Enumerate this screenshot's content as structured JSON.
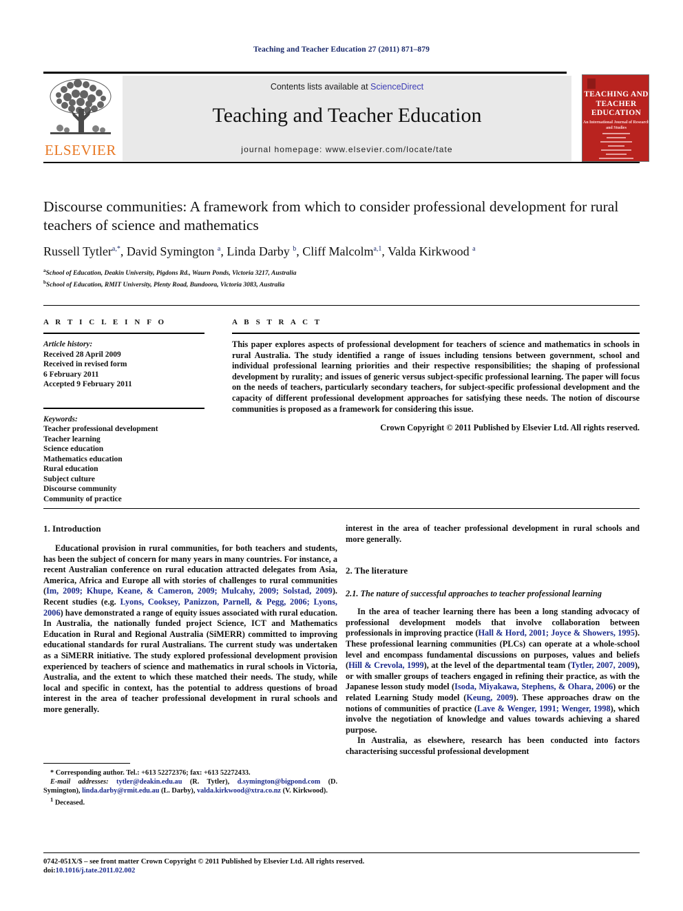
{
  "running_head": "Teaching and Teacher Education 27 (2011) 871–879",
  "masthead": {
    "contents_prefix": "Contents lists available at ",
    "sciencedirect": "ScienceDirect",
    "journal_title": "Teaching and Teacher Education",
    "homepage": "journal homepage: www.elsevier.com/locate/tate",
    "publisher_wordmark": "ELSEVIER",
    "publisher_color": "#e87722",
    "sciencedirect_color": "#3b3bb5",
    "bar_background": "#e9e9e9",
    "cover": {
      "title": "TEACHING AND TEACHER EDUCATION",
      "subtitle": "An International Journal of Research and Studies",
      "background": "#b9231f"
    }
  },
  "article": {
    "title": "Discourse communities: A framework from which to consider professional development for rural teachers of science and mathematics",
    "authors_html": "Russell Tytler<sup>a,*</sup>, David Symington <sup>a</sup>, Linda Darby <sup>b</sup>, Cliff Malcolm<sup>a,1</sup>, Valda Kirkwood <sup>a</sup>",
    "affiliations": [
      "School of Education, Deakin University, Pigdons Rd., Waurn Ponds, Victoria 3217, Australia",
      "School of Education, RMIT University, Plenty Road, Bundoora, Victoria 3083, Australia"
    ],
    "affiliation_markers": [
      "a",
      "b"
    ]
  },
  "article_info": {
    "heading": "A R T I C L E   I N F O",
    "history_label": "Article history:",
    "history": [
      "Received 28 April 2009",
      "Received in revised form",
      "6 February 2011",
      "Accepted 9 February 2011"
    ],
    "keywords_label": "Keywords:",
    "keywords": [
      "Teacher professional development",
      "Teacher learning",
      "Science education",
      "Mathematics education",
      "Rural education",
      "Subject culture",
      "Discourse community",
      "Community of practice"
    ]
  },
  "abstract": {
    "heading": "A B S T R A C T",
    "text": "This paper explores aspects of professional development for teachers of science and mathematics in schools in rural Australia. The study identified a range of issues including tensions between government, school and individual professional learning priorities and their respective responsibilities; the shaping of professional development by rurality; and issues of generic versus subject-specific professional learning. The paper will focus on the needs of teachers, particularly secondary teachers, for subject-specific professional development and the capacity of different professional development approaches for satisfying these needs. The notion of discourse communities is proposed as a framework for considering this issue.",
    "copyright": "Crown Copyright © 2011 Published by Elsevier Ltd. All rights reserved."
  },
  "sections": {
    "introduction_heading": "1. Introduction",
    "literature_heading": "2. The literature",
    "literature_sub_heading": "2.1. The nature of successful approaches to teacher professional learning"
  },
  "body": {
    "intro_p1_a": "Educational provision in rural communities, for both teachers and students, has been the subject of concern for many years in many countries. For instance, a recent Australian conference on rural education attracted delegates from Asia, America, Africa and Europe all with stories of challenges to rural communities (",
    "intro_cite1": "Im, 2009; Khupe, Keane, & Cameron, 2009; Mulcahy, 2009; Solstad, 2009",
    "intro_p1_b": "). Recent studies (e.g. ",
    "intro_cite2": "Lyons, Cooksey, Panizzon, Parnell, & Pegg, 2006; Lyons, 2006",
    "intro_p1_c": ") have demonstrated a range of equity issues associated with rural education. In Australia, the nationally funded project Science, ICT and Mathematics Education in Rural and Regional Australia (SiMERR) committed to improving educational standards for rural Australians. The current study was undertaken as a SiMERR initiative. The study explored professional development provision experienced by teachers of science and mathematics in rural schools in Victoria, Australia, and the extent to which these matched their needs. The study, while local and specific in context, has the potential to address questions of broad interest in the area of teacher professional development in rural schools and more generally.",
    "lit_p1_a": "In the area of teacher learning there has been a long standing advocacy of professional development models that involve collaboration between professionals in improving practice (",
    "lit_cite1": "Hall & Hord, 2001; Joyce & Showers, 1995",
    "lit_p1_b": "). These professional learning communities (PLCs) can operate at a whole-school level and encompass fundamental discussions on purposes, values and beliefs (",
    "lit_cite2": "Hill & Crevola, 1999",
    "lit_p1_c": "), at the level of the departmental team (",
    "lit_cite3": "Tytler, 2007, 2009",
    "lit_p1_d": "), or with smaller groups of teachers engaged in refining their practice, as with the Japanese lesson study model (",
    "lit_cite4": "Isoda, Miyakawa, Stephens, & Ohara, 2006",
    "lit_p1_e": ") or the related Learning Study model (",
    "lit_cite5": "Keung, 2009",
    "lit_p1_f": "). These approaches draw on the notions of communities of practice (",
    "lit_cite6": "Lave & Wenger, 1991; Wenger, 1998",
    "lit_p1_g": "), which involve the negotiation of knowledge and values towards achieving a shared purpose.",
    "lit_p2": "In Australia, as elsewhere, research has been conducted into factors characterising successful professional development"
  },
  "footnotes": {
    "corresponding": "* Corresponding author. Tel.: +613 52272376; fax: +613 52272433.",
    "email_label": "E-mail addresses:",
    "emails": [
      {
        "address": "tytler@deakin.edu.au",
        "owner": "(R. Tytler)"
      },
      {
        "address": "d.symington@bigpond.com",
        "owner": "(D. Symington)"
      },
      {
        "address": "linda.darby@rmit.edu.au",
        "owner": "(L. Darby)"
      },
      {
        "address": "valda.kirkwood@xtra.co.nz",
        "owner": "(V. Kirkwood)"
      }
    ],
    "deceased_marker": "1",
    "deceased": "Deceased."
  },
  "page_footer": {
    "issn_line": "0742-051X/$ – see front matter Crown Copyright © 2011 Published by Elsevier Ltd. All rights reserved.",
    "doi_label": "doi:",
    "doi": "10.1016/j.tate.2011.02.002"
  }
}
